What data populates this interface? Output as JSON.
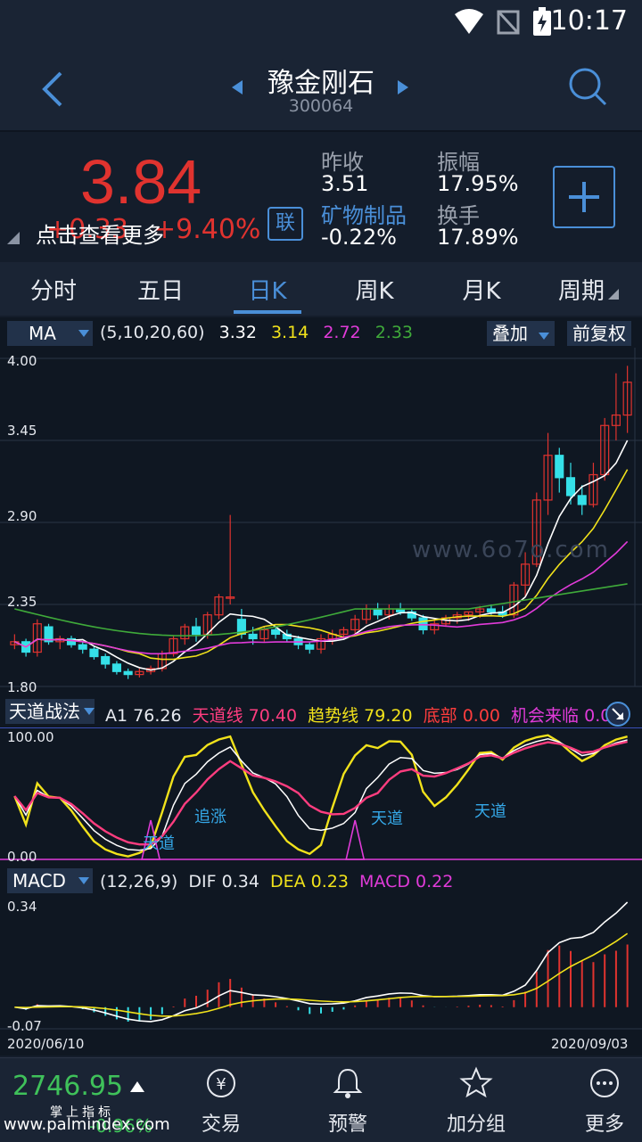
{
  "status_bar": {
    "time": "10:17"
  },
  "header": {
    "stock_name": "豫金刚石",
    "stock_code": "300064"
  },
  "quote": {
    "price": "3.84",
    "change": "+0.33",
    "change_pct": "+9.40%",
    "tap_more": "点击查看更多",
    "link_label": "联",
    "prev_close_label": "昨收",
    "prev_close": "3.51",
    "amplitude_label": "振幅",
    "amplitude": "17.95%",
    "sector": "矿物制品",
    "sector_change": "-0.22%",
    "turnover_label": "换手",
    "turnover": "17.89%"
  },
  "tabs": [
    "分时",
    "五日",
    "日K",
    "周K",
    "月K",
    "周期"
  ],
  "active_tab": "日K",
  "ma_bar": {
    "selector": "MA",
    "params": "(5,10,20,60)",
    "values": [
      "3.32",
      "3.14",
      "2.72",
      "2.33"
    ],
    "overlay": "叠加",
    "adjust": "前复权"
  },
  "kline_axis": [
    "4.00",
    "3.45",
    "2.90",
    "2.35",
    "1.80"
  ],
  "watermark": "www.6o7o.com",
  "indicator": {
    "name": "天道战法",
    "a1_label": "A1",
    "a1": "76.26",
    "tiandao_label": "天道线",
    "tiandao": "70.40",
    "trend_label": "趋势线",
    "trend": "79.20",
    "bottom_label": "底部",
    "bottom": "0.00",
    "chance_label": "机会来临",
    "chance": "0.00",
    "axis": [
      "100.00",
      "0.00"
    ],
    "annotations": [
      "天道",
      "追涨",
      "天道",
      "天道"
    ]
  },
  "macd": {
    "name": "MACD",
    "params": "(12,26,9)",
    "dif_label": "DIF",
    "dif": "0.34",
    "dea_label": "DEA",
    "dea": "0.23",
    "macd_label": "MACD",
    "macd": "0.22",
    "axis": [
      "0.34",
      "-0.07"
    ]
  },
  "dates": {
    "start": "2020/06/10",
    "end": "2020/09/03"
  },
  "bottom_nav": {
    "index_value": "2746.95",
    "index_sub": "-0.96%",
    "index_tag": "掌上指标",
    "site": "www.palmindex.com",
    "items": [
      "交易",
      "预警",
      "加分组",
      "更多"
    ]
  },
  "chart_data": {
    "type": "candlestick",
    "ylim": [
      1.8,
      4.0
    ],
    "candles": [
      [
        2.08,
        2.15,
        2.05,
        2.1
      ],
      [
        2.1,
        2.12,
        2.0,
        2.03
      ],
      [
        2.03,
        2.25,
        2.0,
        2.22
      ],
      [
        2.2,
        2.22,
        2.08,
        2.1
      ],
      [
        2.1,
        2.14,
        2.05,
        2.12
      ],
      [
        2.12,
        2.14,
        2.06,
        2.08
      ],
      [
        2.08,
        2.1,
        2.02,
        2.05
      ],
      [
        2.05,
        2.07,
        1.98,
        2.0
      ],
      [
        2.0,
        2.02,
        1.92,
        1.95
      ],
      [
        1.95,
        1.97,
        1.88,
        1.9
      ],
      [
        1.9,
        1.92,
        1.85,
        1.88
      ],
      [
        1.88,
        1.92,
        1.86,
        1.9
      ],
      [
        1.9,
        1.94,
        1.88,
        1.92
      ],
      [
        1.92,
        2.04,
        1.9,
        2.02
      ],
      [
        2.02,
        2.14,
        2.0,
        2.12
      ],
      [
        2.12,
        2.22,
        2.08,
        2.2
      ],
      [
        2.2,
        2.26,
        2.1,
        2.15
      ],
      [
        2.15,
        2.3,
        2.12,
        2.28
      ],
      [
        2.28,
        2.42,
        2.25,
        2.4
      ],
      [
        2.4,
        2.95,
        2.35,
        2.4
      ],
      [
        2.25,
        2.32,
        2.12,
        2.15
      ],
      [
        2.15,
        2.2,
        2.08,
        2.12
      ],
      [
        2.12,
        2.2,
        2.1,
        2.18
      ],
      [
        2.18,
        2.2,
        2.12,
        2.15
      ],
      [
        2.15,
        2.18,
        2.1,
        2.12
      ],
      [
        2.12,
        2.14,
        2.05,
        2.08
      ],
      [
        2.08,
        2.1,
        2.02,
        2.05
      ],
      [
        2.05,
        2.15,
        2.02,
        2.12
      ],
      [
        2.12,
        2.18,
        2.08,
        2.15
      ],
      [
        2.15,
        2.2,
        2.12,
        2.18
      ],
      [
        2.18,
        2.28,
        2.15,
        2.25
      ],
      [
        2.25,
        2.35,
        2.22,
        2.32
      ],
      [
        2.32,
        2.36,
        2.25,
        2.28
      ],
      [
        2.28,
        2.35,
        2.25,
        2.32
      ],
      [
        2.32,
        2.36,
        2.28,
        2.3
      ],
      [
        2.3,
        2.32,
        2.24,
        2.26
      ],
      [
        2.26,
        2.28,
        2.15,
        2.18
      ],
      [
        2.18,
        2.25,
        2.15,
        2.22
      ],
      [
        2.22,
        2.28,
        2.2,
        2.26
      ],
      [
        2.26,
        2.3,
        2.22,
        2.28
      ],
      [
        2.28,
        2.3,
        2.24,
        2.3
      ],
      [
        2.3,
        2.34,
        2.26,
        2.32
      ],
      [
        2.32,
        2.35,
        2.28,
        2.3
      ],
      [
        2.3,
        2.34,
        2.26,
        2.28
      ],
      [
        2.28,
        2.5,
        2.26,
        2.48
      ],
      [
        2.48,
        2.7,
        2.4,
        2.62
      ],
      [
        2.62,
        3.1,
        2.6,
        3.05
      ],
      [
        3.05,
        3.5,
        2.95,
        3.35
      ],
      [
        3.35,
        3.4,
        3.1,
        3.2
      ],
      [
        3.2,
        3.3,
        3.02,
        3.08
      ],
      [
        3.08,
        3.15,
        2.95,
        3.02
      ],
      [
        3.02,
        3.3,
        3.0,
        3.22
      ],
      [
        3.22,
        3.6,
        3.18,
        3.55
      ],
      [
        3.55,
        3.9,
        3.45,
        3.62
      ],
      [
        3.62,
        3.95,
        3.5,
        3.84
      ]
    ],
    "ma_series": [
      {
        "name": "MA5",
        "color": "#ffffff"
      },
      {
        "name": "MA10",
        "color": "#f1e21b"
      },
      {
        "name": "MA20",
        "color": "#e13bd9"
      },
      {
        "name": "MA60",
        "color": "#3faa3a"
      }
    ]
  },
  "colors": {
    "up": "#e0332f",
    "down": "#35e0e8",
    "accent": "#4a8fd8",
    "ma5": "#ffffff",
    "ma10": "#f1e21b",
    "ma20": "#e13bd9",
    "ma60": "#3faa3a",
    "green_index": "#3fc15a"
  }
}
